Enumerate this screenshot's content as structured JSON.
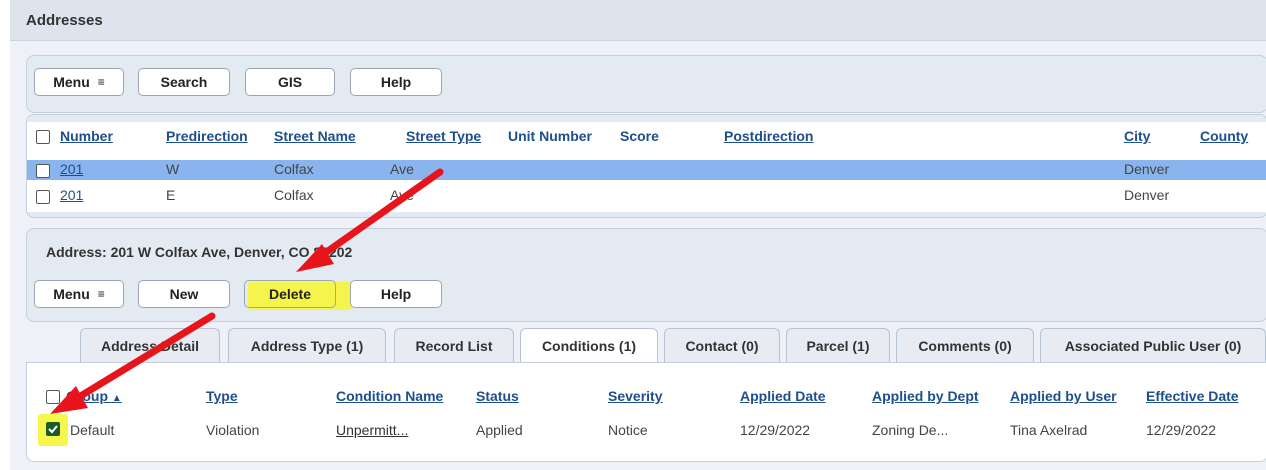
{
  "section_title": "Addresses",
  "top_toolbar": {
    "menu_label": "Menu",
    "search_label": "Search",
    "gis_label": "GIS",
    "help_label": "Help"
  },
  "address_table": {
    "columns": [
      "Number",
      "Predirection",
      "Street Name",
      "Street Type",
      "Unit Number",
      "Score",
      "Postdirection",
      "City",
      "County"
    ],
    "rows": [
      {
        "number": "201",
        "predirection": "W",
        "street_name": "Colfax",
        "street_type": "Ave",
        "city": "Denver",
        "selected": true
      },
      {
        "number": "201",
        "predirection": "E",
        "street_name": "Colfax",
        "street_type": "Ave",
        "city": "Denver",
        "selected": false
      }
    ]
  },
  "detail": {
    "address_label": "Address: 201 W Colfax Ave,  Denver, CO 80202",
    "menu_label": "Menu",
    "new_label": "New",
    "delete_label": "Delete",
    "help_label": "Help"
  },
  "tabs": [
    {
      "label": "Address Detail",
      "active": false
    },
    {
      "label": "Address Type (1)",
      "active": false
    },
    {
      "label": "Record List",
      "active": false
    },
    {
      "label": "Conditions (1)",
      "active": true
    },
    {
      "label": "Contact (0)",
      "active": false
    },
    {
      "label": "Parcel (1)",
      "active": false
    },
    {
      "label": "Comments (0)",
      "active": false
    },
    {
      "label": "Associated Public User (0)",
      "active": false
    }
  ],
  "conditions_table": {
    "columns": [
      "Group",
      "Type",
      "Condition Name",
      "Status",
      "Severity",
      "Applied Date",
      "Applied by Dept",
      "Applied by User",
      "Effective Date"
    ],
    "sort_indicator": "▲",
    "rows": [
      {
        "group": "Default",
        "type": "Violation",
        "condition_name": "Unpermitt...",
        "status": "Applied",
        "severity": "Notice",
        "applied_date": "12/29/2022",
        "applied_by_dept": "Zoning De...",
        "applied_by_user": "Tina Axelrad",
        "effective_date": "12/29/2022",
        "checked": true
      }
    ]
  },
  "colors": {
    "link": "#1e4f8c",
    "selected_row": "#8ab4ee",
    "highlight": "#f5f53a",
    "arrow": "#e8141b"
  }
}
